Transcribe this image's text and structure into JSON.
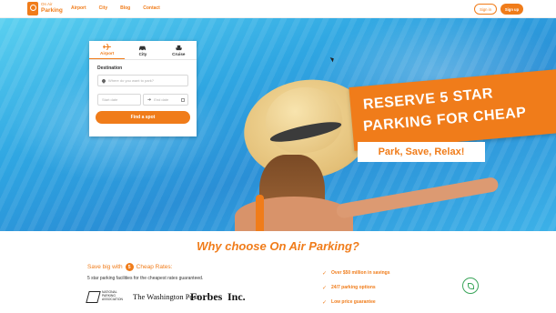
{
  "header": {
    "logo_top": "On Air",
    "logo_bottom": "Parking",
    "nav": [
      "Airport",
      "City",
      "Blog",
      "Contact"
    ],
    "signin_label": "Sign in",
    "signup_label": "Sign up"
  },
  "search": {
    "tabs": [
      {
        "label": "Airport",
        "icon": "plane-icon",
        "active": true
      },
      {
        "label": "City",
        "icon": "car-icon",
        "active": false
      },
      {
        "label": "Cruise",
        "icon": "ship-icon",
        "active": false
      }
    ],
    "destination_label": "Destination",
    "destination_placeholder": "Where do you want to park?",
    "start_placeholder": "Start date",
    "end_placeholder": "End date",
    "find_label": "Find a spot"
  },
  "hero": {
    "banner_line1": "RESERVE 5 STAR",
    "banner_line2": "PARKING FOR CHEAP",
    "tagline": "Park, Save, Relax!"
  },
  "why": {
    "title": "Why choose On Air Parking?",
    "save_prefix": "Save big with",
    "save_number": "5",
    "save_suffix": "Cheap Rates:",
    "save_desc": "5 star parking facilities for the cheapest rates guaranteed.",
    "press": {
      "npa": "NATIONAL PARKING ASSOCIATION",
      "wp": "The Washington Post",
      "forbes": "Forbes",
      "inc": "Inc."
    },
    "benefits": [
      "Over $50 million in savings",
      "24/7 parking options",
      "Low price guarantee"
    ]
  },
  "colors": {
    "accent": "#f07c1a",
    "eco": "#3aa55a"
  }
}
